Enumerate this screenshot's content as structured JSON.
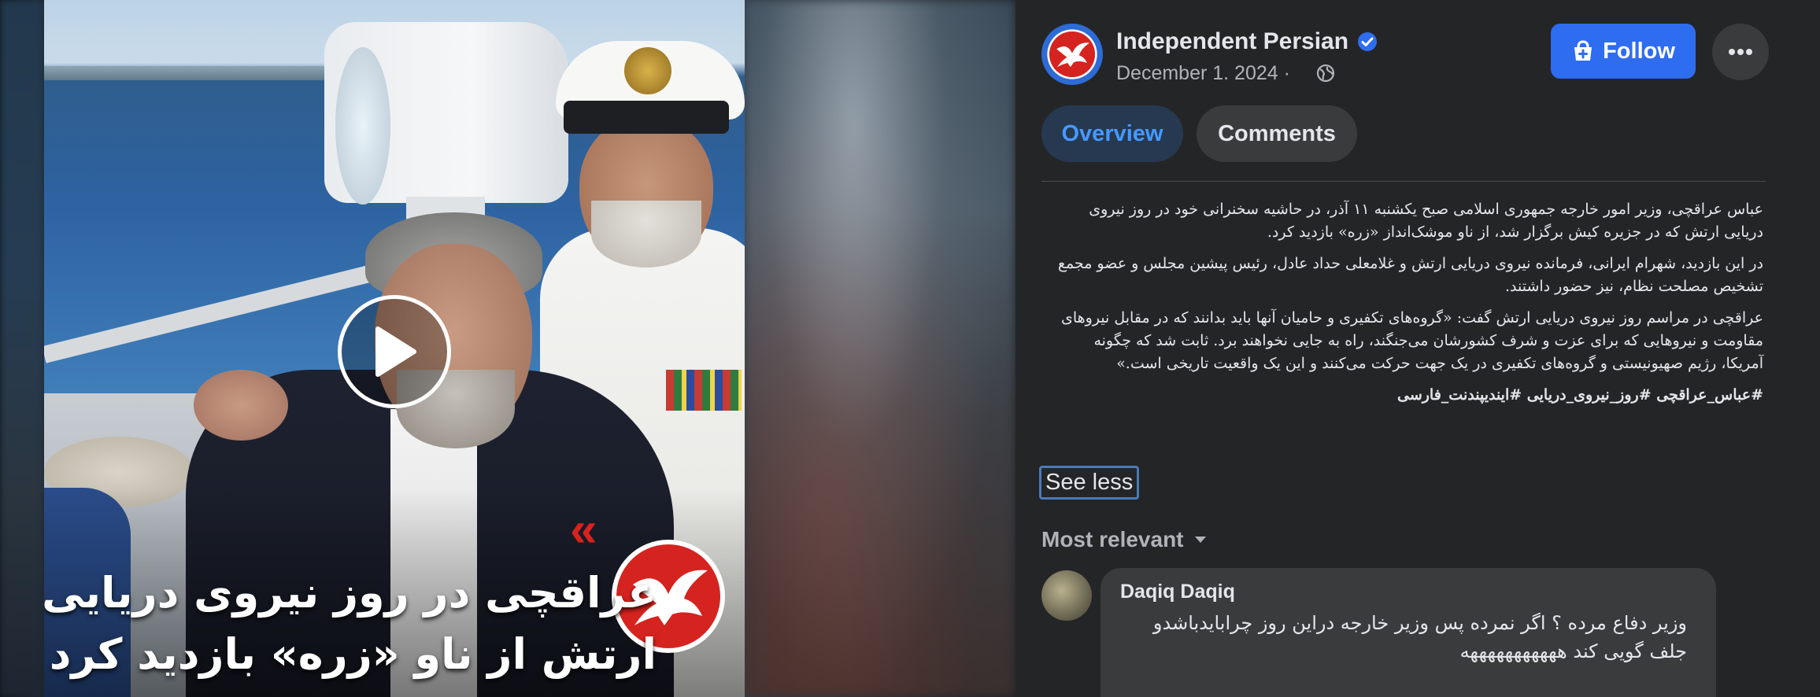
{
  "video": {
    "caption_line_1": "عراقچی در روز نیروی دریایی",
    "caption_line_2": "ارتش از ناو «زره» بازدید کرد",
    "brand_arrows": "«"
  },
  "post": {
    "page_name": "Independent Persian",
    "date": "December 1. 2024 ·",
    "follow_label": "Follow",
    "tabs": [
      "Overview",
      "Comments"
    ],
    "paragraphs": [
      "عباس عراقچی، وزیر امور خارجه جمهوری اسلامی صبح یکشنبه ۱۱ آذر، در حاشیه سخنرانی خود در روز نیروی دریایی ارتش که در جزیره کیش برگزار شد، از ناو موشک‌انداز «زره» بازدید کرد.",
      "در این بازدید، شهرام ایرانی، فرمانده نیروی دریایی ارتش و غلامعلی حداد عادل، رئیس پیشین مجلس و عضو مجمع تشخیص مصلحت نظام، نیز حضور داشتند.",
      "عراقچی در مراسم روز نیروی دریایی ارتش گفت: «گروه‌های تکفیری و حامیان آنها باید بدانند که در مقابل نیروهای مقاومت و نیروهایی که برای عزت و شرف کشورشان می‌جنگند، راه به جایی نخواهند برد. ثابت شد که چگونه آمریکا، رژیم صهیونیستی و گروه‌های تکفیری در یک جهت حرکت می‌کنند و این یک واقعیت تاریخی است.»"
    ],
    "hashtags": "#عباس_عراقچی #روز_نیروی_دریایی #ایندیپندنت_فارسی",
    "see_less_label": "See less",
    "sort_label": "Most relevant"
  },
  "comments": [
    {
      "author": "Daqiq Daqiq",
      "text": "وزیر دفاع مرده ؟ اگر نمرده پس وزیر خارجه دراین روز چرابایدباشدو جلف گویی کند هههههههههههه"
    }
  ],
  "colors": {
    "accent": "#2e6cf0",
    "brand_red": "#d5231f",
    "panel_bg": "#242526",
    "tab_active_bg": "#263951",
    "tab_active_text": "#4599ff"
  },
  "icons": [
    "play-icon",
    "eagle-logo-icon",
    "verified-badge-icon",
    "globe-icon",
    "follow-page-icon",
    "more-dots-icon",
    "chevron-down-icon"
  ]
}
